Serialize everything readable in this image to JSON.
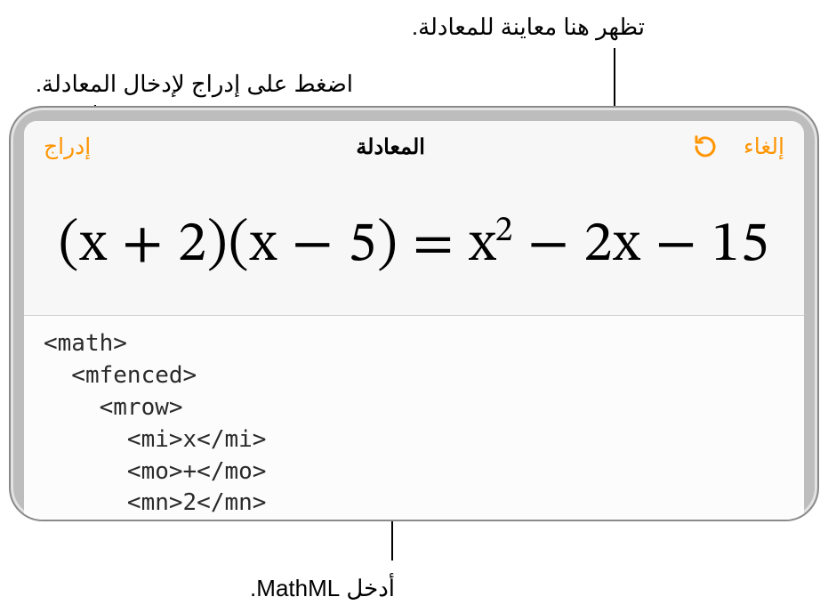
{
  "callouts": {
    "preview_here": "تظهر هنا معاينة للمعادلة.",
    "tap_insert": "اضغط على إدراج لإدخال المعادلة.",
    "enter_mathml": "أدخل MathML."
  },
  "toolbar": {
    "cancel_label": "إلغاء",
    "insert_label": "إدراج",
    "title": "المعادلة",
    "redo_icon_name": "redo-icon"
  },
  "preview": {
    "equation_text": "(x + 2)(x − 5) = x² − 2x − 15",
    "equation_html": "(x + 2)(x − 5) = x<sup>2</sup> − 2x − 15"
  },
  "source": {
    "code": "<math>\n  <mfenced>\n    <mrow>\n      <mi>x</mi>\n      <mo>+</mo>\n      <mn>2</mn>"
  }
}
